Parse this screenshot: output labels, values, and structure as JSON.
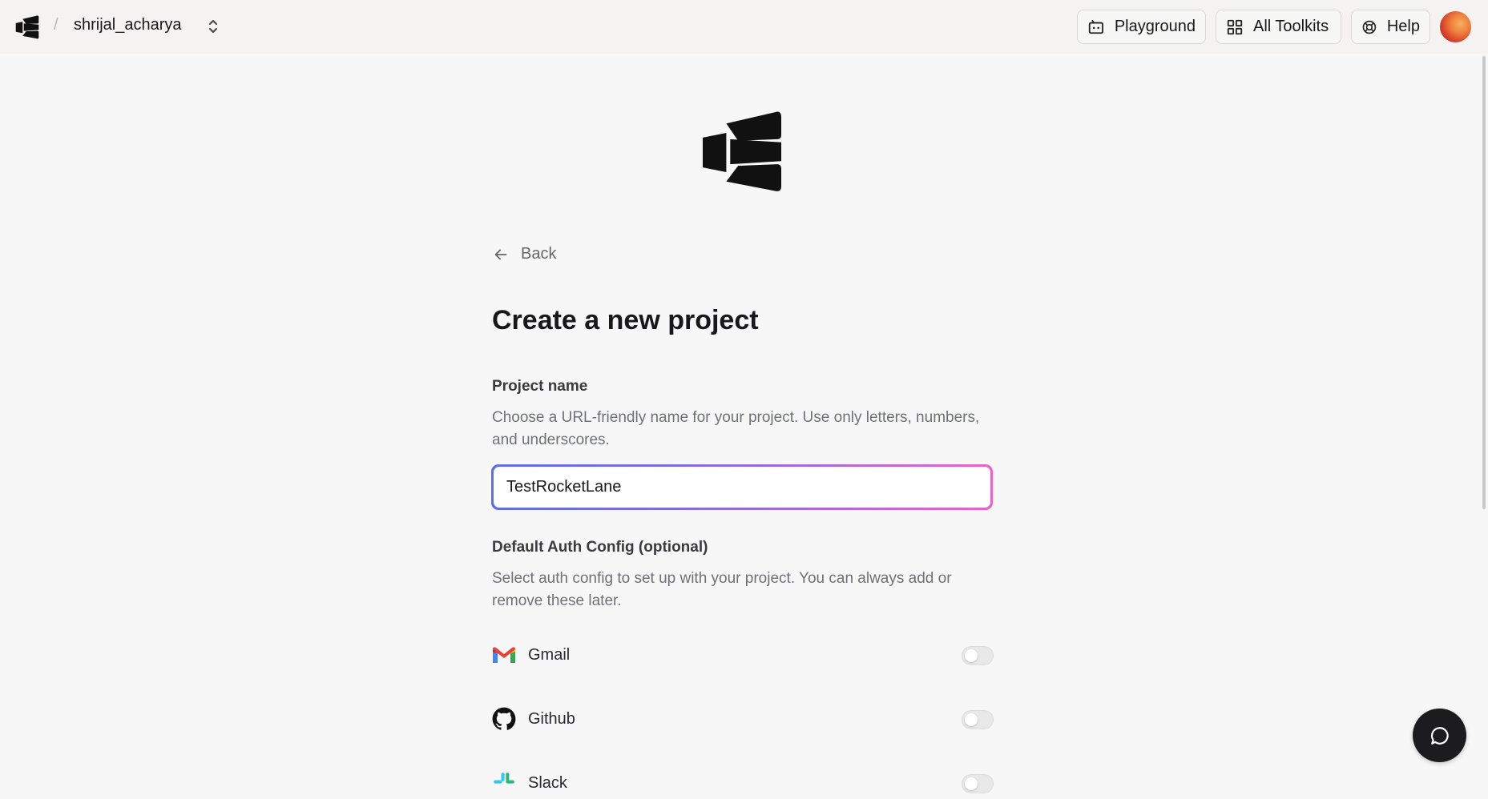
{
  "header": {
    "separator": "/",
    "workspace_name": "shrijal_acharya",
    "buttons": {
      "playground": "Playground",
      "all_toolkits": "All Toolkits",
      "help": "Help"
    }
  },
  "page": {
    "back_label": "Back",
    "title": "Create a new project",
    "project_name": {
      "label": "Project name",
      "help": "Choose a URL-friendly name for your project. Use only letters, numbers, and underscores.",
      "value": "TestRocketLane"
    },
    "auth_config": {
      "label": "Default Auth Config (optional)",
      "help": "Select auth config to set up with your project. You can always add or remove these later.",
      "toolkits": [
        {
          "name": "Gmail",
          "icon": "gmail-icon",
          "enabled": false
        },
        {
          "name": "Github",
          "icon": "github-icon",
          "enabled": false
        },
        {
          "name": "Slack",
          "icon": "slack-icon",
          "enabled": false
        }
      ]
    }
  },
  "colors": {
    "input_gradient_start": "#5e6ee8",
    "input_gradient_end": "#ec63c9",
    "chat_button": "#1c1c1f"
  }
}
